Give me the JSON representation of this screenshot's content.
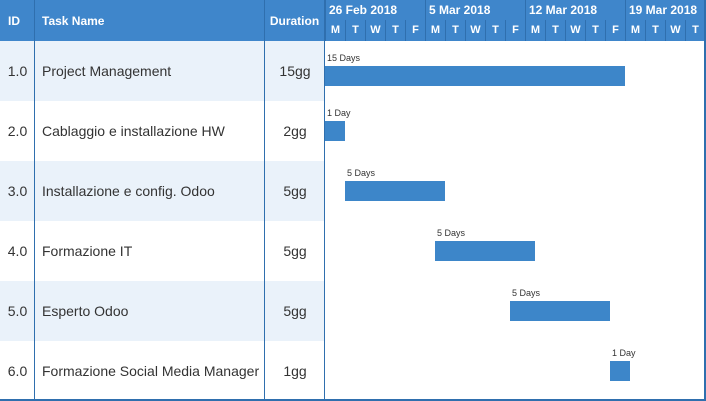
{
  "header": {
    "id_label": "ID",
    "task_label": "Task Name",
    "duration_label": "Duration",
    "weeks": [
      "26 Feb 2018",
      "5 Mar 2018",
      "12 Mar 2018",
      "19 Mar 2018"
    ],
    "days": [
      "M",
      "T",
      "W",
      "T",
      "F",
      "M",
      "T",
      "W",
      "T",
      "F",
      "M",
      "T",
      "W",
      "T",
      "F",
      "M",
      "T",
      "W",
      "T"
    ]
  },
  "rows": [
    {
      "id": "1.0",
      "name": "Project Management",
      "duration": "15gg",
      "bar_label": "15 Days",
      "start_day": 0,
      "length_days": 15
    },
    {
      "id": "2.0",
      "name": "Cablaggio e installazione HW",
      "duration": "2gg",
      "bar_label": "1 Day",
      "start_day": 0,
      "length_days": 1
    },
    {
      "id": "3.0",
      "name": "Installazione e config. Odoo",
      "duration": "5gg",
      "bar_label": "5 Days",
      "start_day": 1,
      "length_days": 5
    },
    {
      "id": "4.0",
      "name": "Formazione IT",
      "duration": "5gg",
      "bar_label": "5 Days",
      "start_day": 5.5,
      "length_days": 5
    },
    {
      "id": "5.0",
      "name": "Esperto Odoo",
      "duration": "5gg",
      "bar_label": "5 Days",
      "start_day": 9.25,
      "length_days": 5
    },
    {
      "id": "6.0",
      "name": "Formazione Social Media Manager",
      "duration": "1gg",
      "bar_label": "1 Day",
      "start_day": 14.25,
      "length_days": 1
    }
  ],
  "colors": {
    "header": "#3f86cb",
    "bar": "#3d86c9",
    "row_alt": "#eaf2fa",
    "grid_line": "#2f6fae"
  }
}
